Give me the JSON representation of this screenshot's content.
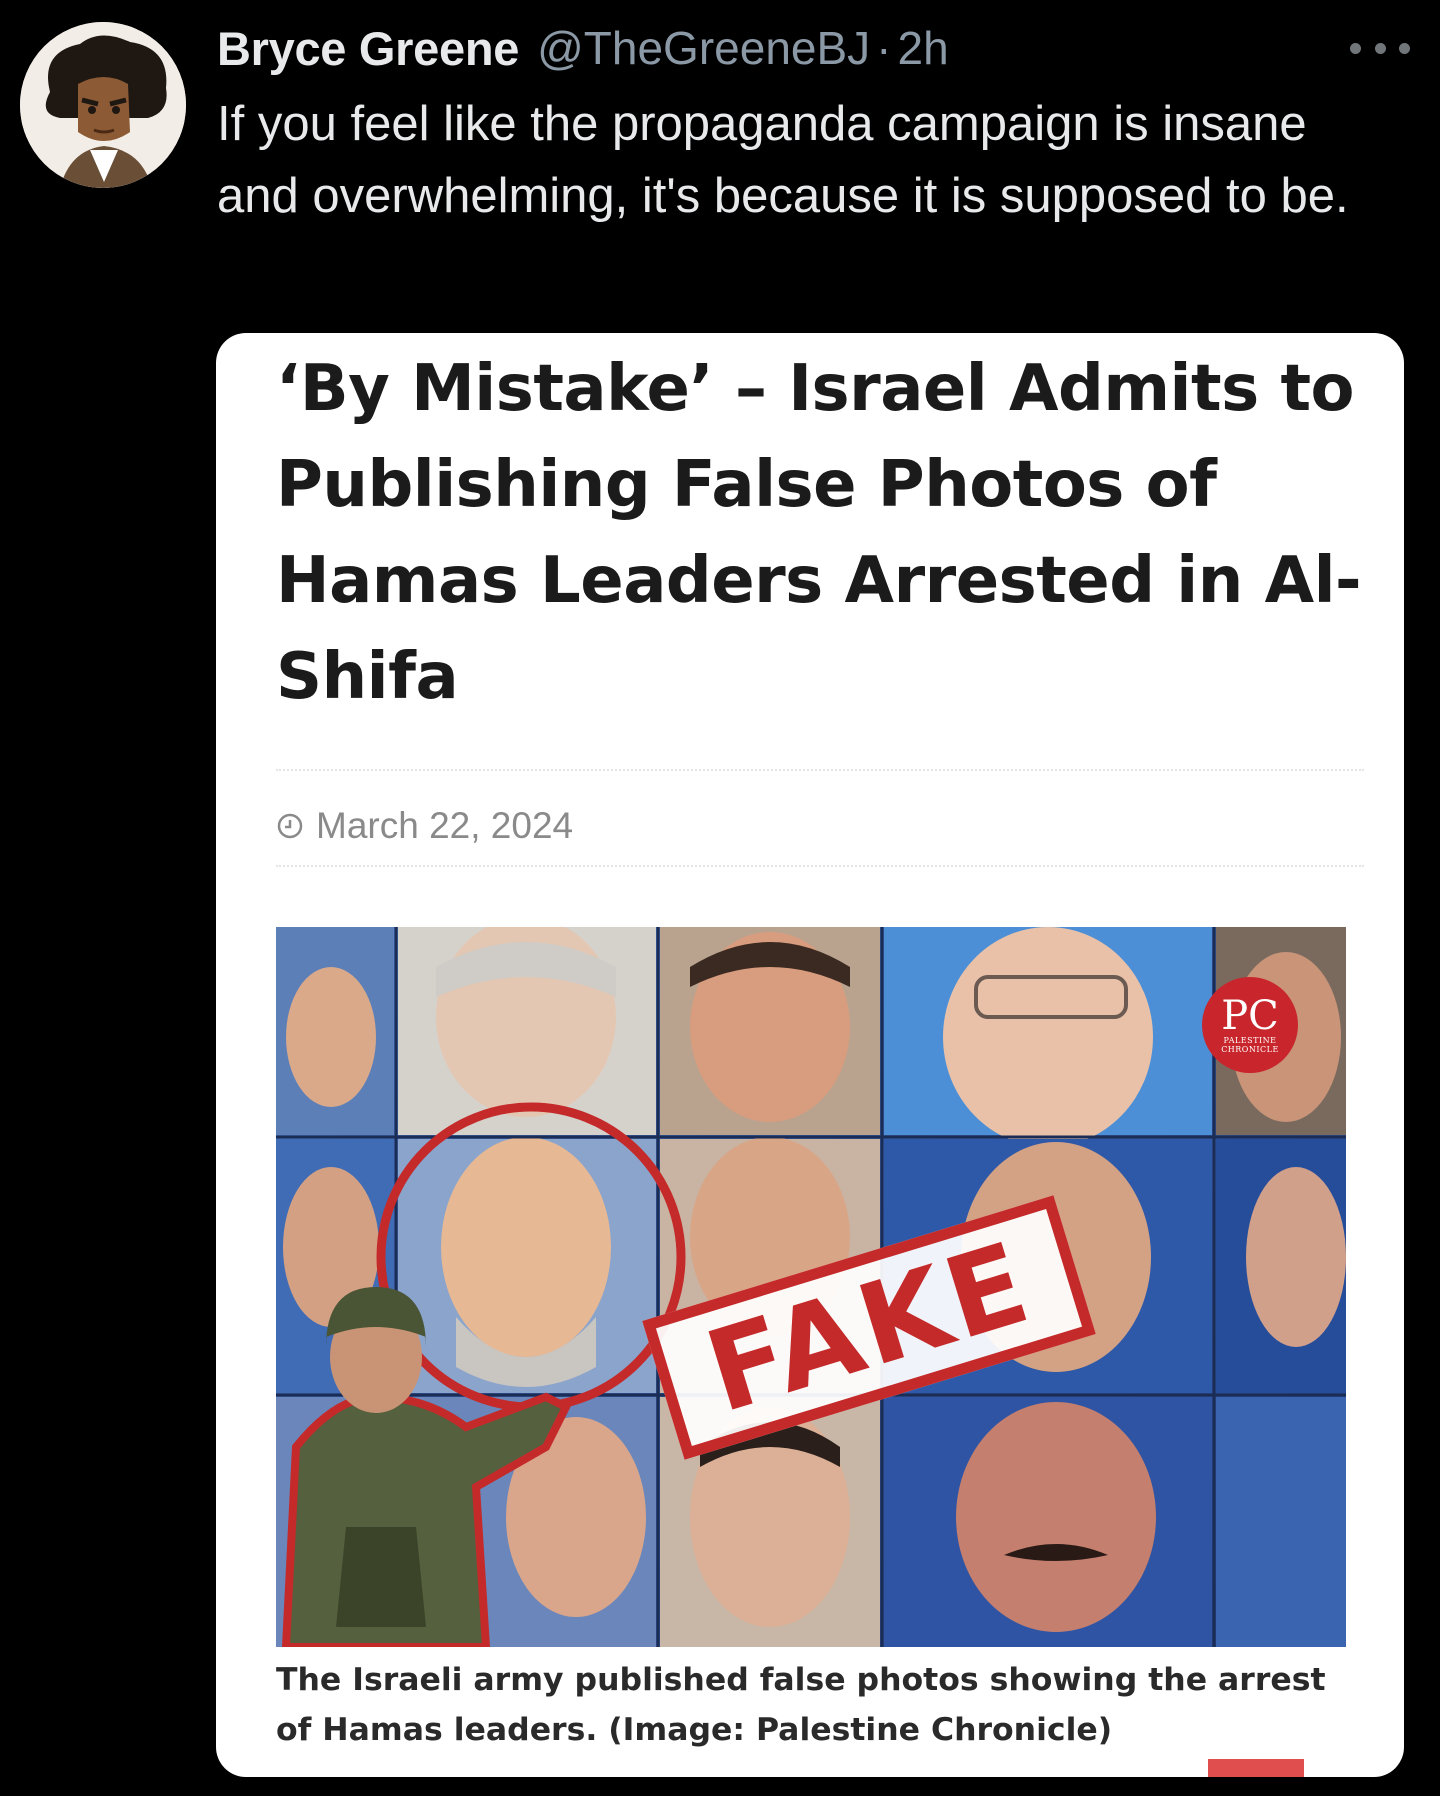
{
  "author": {
    "display_name": "Bryce Greene",
    "handle": "@TheGreeneBJ",
    "separator": "·",
    "time": "2h"
  },
  "tweet_text": "If you feel like the propaganda campaign is insane and overwhelming, it's because it is supposed to be.",
  "card": {
    "headline": "‘By Mistake’ – Israel Admits to Publishing False Photos of Hamas Leaders Arrested in Al-Shifa",
    "date": "March 22, 2024",
    "stamp_text": "FAKE",
    "badge": {
      "letters": "PC",
      "small": "PALESTINE CHRONICLE"
    },
    "caption": "The Israeli army published false photos showing the arrest of Hamas leaders. (Image: Palestine Chronicle)"
  },
  "icons": [
    "more-icon",
    "clock-icon"
  ],
  "colors": {
    "background": "#000000",
    "text_primary": "#e7e9ea",
    "text_secondary": "#8b98a5",
    "card_bg": "#ffffff",
    "stamp_red": "#c42a2a"
  }
}
